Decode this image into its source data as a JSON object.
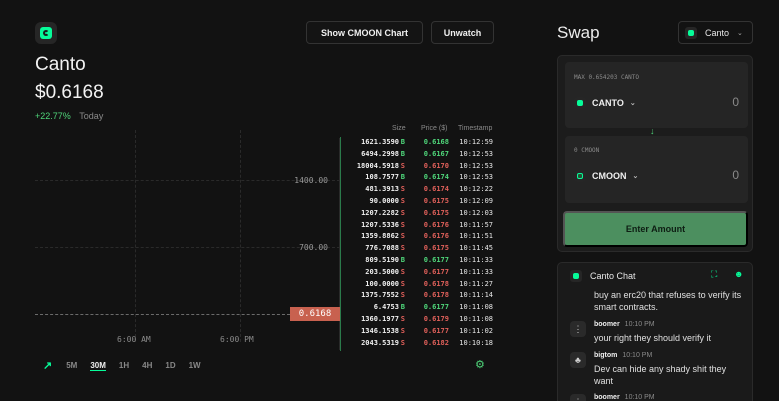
{
  "token": {
    "name": "Canto",
    "price": "$0.6168",
    "change_pct": "+22.77%",
    "change_period": "Today"
  },
  "header": {
    "show_chart_label": "Show CMOON Chart",
    "unwatch_label": "Unwatch"
  },
  "chart": {
    "y_ticks": [
      "1400.00",
      "700.00"
    ],
    "x_ticks": [
      "6:00 AM",
      "6:00 PM"
    ],
    "current_price_tag": "0.6168"
  },
  "timeframes": [
    "5M",
    "30M",
    "1H",
    "4H",
    "1D",
    "1W"
  ],
  "timeframe_active": "30M",
  "order_book": {
    "headers": {
      "size": "Size",
      "price": "Price ($)",
      "timestamp": "Timestamp"
    },
    "rows": [
      {
        "size": "1621.3590",
        "side": "B",
        "price": "0.6168",
        "time": "10:12:59"
      },
      {
        "size": "6494.2998",
        "side": "B",
        "price": "0.6167",
        "time": "10:12:53"
      },
      {
        "size": "18004.5918",
        "side": "S",
        "price": "0.6170",
        "time": "10:12:53"
      },
      {
        "size": "108.7577",
        "side": "B",
        "price": "0.6174",
        "time": "10:12:53"
      },
      {
        "size": "481.3913",
        "side": "S",
        "price": "0.6174",
        "time": "10:12:22"
      },
      {
        "size": "90.0000",
        "side": "S",
        "price": "0.6175",
        "time": "10:12:09"
      },
      {
        "size": "1207.2282",
        "side": "S",
        "price": "0.6175",
        "time": "10:12:03"
      },
      {
        "size": "1207.5336",
        "side": "S",
        "price": "0.6176",
        "time": "10:11:57"
      },
      {
        "size": "1359.8862",
        "side": "S",
        "price": "0.6176",
        "time": "10:11:51"
      },
      {
        "size": "776.7088",
        "side": "S",
        "price": "0.6175",
        "time": "10:11:45"
      },
      {
        "size": "809.5190",
        "side": "B",
        "price": "0.6177",
        "time": "10:11:33"
      },
      {
        "size": "203.5000",
        "side": "S",
        "price": "0.6177",
        "time": "10:11:33"
      },
      {
        "size": "100.0000",
        "side": "S",
        "price": "0.6178",
        "time": "10:11:27"
      },
      {
        "size": "1375.7552",
        "side": "S",
        "price": "0.6178",
        "time": "10:11:14"
      },
      {
        "size": "6.4753",
        "side": "B",
        "price": "0.6177",
        "time": "10:11:08"
      },
      {
        "size": "1360.1977",
        "side": "S",
        "price": "0.6179",
        "time": "10:11:08"
      },
      {
        "size": "1346.1538",
        "side": "S",
        "price": "0.6177",
        "time": "10:11:02"
      },
      {
        "size": "2043.5319",
        "side": "S",
        "price": "0.6182",
        "time": "10:10:18"
      }
    ]
  },
  "swap": {
    "title": "Swap",
    "network_selector": "Canto",
    "from_max_label": "MAX 0.654203 CANTO",
    "from_token": "CANTO",
    "from_amount": "0",
    "to_balance_label": "0 CMOON",
    "to_token": "CMOON",
    "to_amount": "0",
    "enter_amount_label": "Enter Amount"
  },
  "chat": {
    "title": "Canto Chat",
    "first_text": "buy an erc20 that refuses to verify its smart contracts.",
    "messages": [
      {
        "user": "boomer",
        "time": "10:10 PM",
        "text": "your right they should verify it"
      },
      {
        "user": "bigtom",
        "time": "10:10 PM",
        "text": "Dev can hide any shady shit they want"
      },
      {
        "user": "boomer",
        "time": "10:10 PM",
        "text": ""
      }
    ]
  },
  "colors": {
    "background": "#121212",
    "accent_green": "#06fc99",
    "buy": "#4fd67a",
    "sell": "#e0605a",
    "price_tag": "#c8614f",
    "enter_button": "#4c8f5f"
  }
}
